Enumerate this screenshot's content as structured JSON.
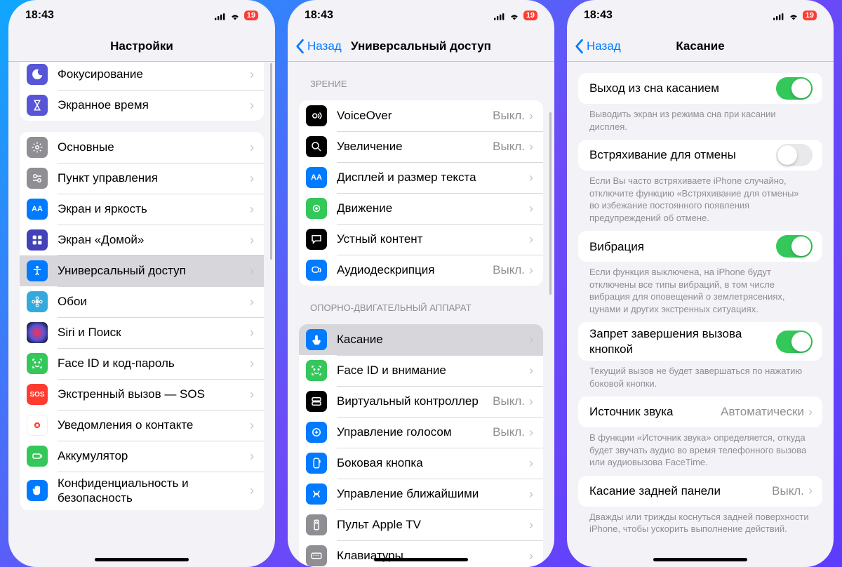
{
  "status": {
    "time": "18:43",
    "battery": "19"
  },
  "phone1": {
    "title": "Настройки",
    "rows": {
      "focus": "Фокусирование",
      "screentime": "Экранное время",
      "general": "Основные",
      "control": "Пункт управления",
      "display": "Экран и яркость",
      "home": "Экран «Домой»",
      "accessibility": "Универсальный доступ",
      "wallpaper": "Обои",
      "siri": "Siri и Поиск",
      "faceid": "Face ID и код-пароль",
      "sos": "Экстренный вызов — SOS",
      "contactnotif": "Уведомления о контакте",
      "battery": "Аккумулятор",
      "privacy": "Конфиденциальность и безопасность"
    }
  },
  "phone2": {
    "back": "Назад",
    "title": "Универсальный доступ",
    "headers": {
      "vision": "Зрение",
      "motor": "Опорно-двигательный аппарат"
    },
    "rows": {
      "voiceover": "VoiceOver",
      "zoom": "Увеличение",
      "displaytext": "Дисплей и размер текста",
      "motion": "Движение",
      "spoken": "Устный контент",
      "audiodesc": "Аудиодескрипция",
      "touch": "Касание",
      "faceid": "Face ID и внимание",
      "virtual": "Виртуальный контроллер",
      "voice": "Управление голосом",
      "sidebtn": "Боковая кнопка",
      "nearby": "Управление ближайшими",
      "appletv": "Пульт Apple TV",
      "keyboards": "Клавиатуры"
    },
    "off": "Выкл."
  },
  "phone3": {
    "back": "Назад",
    "title": "Касание",
    "rows": {
      "tapwake": "Выход из сна касанием",
      "shake": "Встряхивание для отмены",
      "vibration": "Вибрация",
      "endcall": "Запрет завершения вызова кнопкой",
      "audioroute": "Источник звука",
      "backtap": "Касание задней панели"
    },
    "states": {
      "audioroute": "Автоматически",
      "backtap": "Выкл."
    },
    "footers": {
      "tapwake": "Выводить экран из режима сна при касании дисплея.",
      "shake": "Если Вы часто встряхиваете iPhone случайно, отключите функцию «Встряхивание для отмены» во избежание постоянного появления предупреждений об отмене.",
      "vibration": "Если функция выключена, на iPhone будут отключены все типы вибраций, в том числе вибрация для оповещений о землетрясениях, цунами и других экстренных ситуациях.",
      "endcall": "Текущий вызов не будет завершаться по нажатию боковой кнопки.",
      "audioroute": "В функции «Источник звука» определяется, откуда будет звучать аудио во время телефонного вызова или аудиовызова FaceTime.",
      "backtap": "Дважды или трижды коснуться задней поверхности iPhone, чтобы ускорить выполнение действий."
    }
  }
}
